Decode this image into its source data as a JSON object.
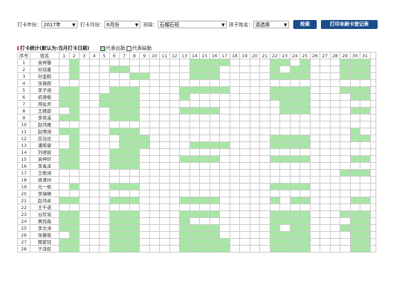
{
  "filters": {
    "year_label": "打卡年份：",
    "year_value": "2017年",
    "month_label": "打卡月份：",
    "month_value": "6月份",
    "class_label": "班级：",
    "class_value": "石榴石班",
    "child_label": "孩子姓名：",
    "child_value": "请选择",
    "search_button": "检索",
    "print_button": "打印未刷卡登记表"
  },
  "legend": {
    "title": "打卡统计(默认为:当月打卡日期)",
    "present_label": "代表出勤",
    "absent_label": "代表缺勤",
    "present_color": "#a8e6a6",
    "absent_color": "#ffffff"
  },
  "table": {
    "headers": [
      "序号",
      "姓名",
      "1",
      "2",
      "3",
      "4",
      "5",
      "6",
      "7",
      "8",
      "9",
      "10",
      "11",
      "12",
      "13",
      "14",
      "15",
      "16",
      "17",
      "18",
      "19",
      "20",
      "21",
      "22",
      "23",
      "24",
      "25",
      "26",
      "27",
      "28",
      "29",
      "30",
      "31"
    ],
    "rows": [
      {
        "no": "1",
        "name": "袁梓馨",
        "days": "0100000000000111100001101000111100"
      },
      {
        "no": "2",
        "name": "孙羽墨",
        "days": "0100011000000111000001011000111100"
      },
      {
        "no": "3",
        "name": "孙金鹤",
        "days": "0100000110000111000001111000111100"
      },
      {
        "no": "4",
        "name": "张瀚辰",
        "days": "0000000000000000000000000000000000"
      },
      {
        "no": "5",
        "name": "李子涵",
        "days": "1100011100001111100001111000111100"
      },
      {
        "no": "6",
        "name": "初语楷",
        "days": "1100111100001000000001111000011100"
      },
      {
        "no": "7",
        "name": "周祉灵",
        "days": "1100111100000000000000111000000000"
      },
      {
        "no": "8",
        "name": "王婧歆",
        "days": "0100011100001111000000111000011100"
      },
      {
        "no": "9",
        "name": "李将溪",
        "days": "1100011100000000000000000000000000"
      },
      {
        "no": "10",
        "name": "赵鸿雅",
        "days": "0000000000000000000000000000000000"
      },
      {
        "no": "11",
        "name": "赵晴涵",
        "days": "1100011100000000000000000000010000"
      },
      {
        "no": "12",
        "name": "房泊达",
        "days": "0100001110000000000001111000011100"
      },
      {
        "no": "13",
        "name": "潘皓睿",
        "days": "0100001110000111100001111000000000"
      },
      {
        "no": "14",
        "name": "刘语宸",
        "days": "1100011100000000000000000000000000"
      },
      {
        "no": "15",
        "name": "袁梓轩",
        "days": "1100011100001111000001111000011100"
      },
      {
        "no": "16",
        "name": "李禹泽",
        "days": "1100011100000000000000000000000000"
      },
      {
        "no": "17",
        "name": "王楔涵",
        "days": "0000000000000000000000000000111100"
      },
      {
        "no": "18",
        "name": "梁潇州",
        "days": "0000000000000000000000000000000000"
      },
      {
        "no": "19",
        "name": "元一帆",
        "days": "0100011100000000000001111000000000"
      },
      {
        "no": "20",
        "name": "李瑞琳",
        "days": "0000000000000000000000000000000100"
      },
      {
        "no": "21",
        "name": "赵鸿卓",
        "days": "1100011100001111000001011000011100"
      },
      {
        "no": "22",
        "name": "王千诺",
        "days": "0000000000000000000000000000000000"
      },
      {
        "no": "23",
        "name": "谷欣谣",
        "days": "1100011100001111000001111000111100"
      },
      {
        "no": "24",
        "name": "黄冠森",
        "days": "1100011100001000000001111000011100"
      },
      {
        "no": "25",
        "name": "李文涛",
        "days": "1100011100001111000001011000111100"
      },
      {
        "no": "26",
        "name": "张馨筱",
        "days": "0100011100001111000001111000011100"
      },
      {
        "no": "27",
        "name": "鲍紫钰",
        "days": "1100011100001111100001111000011100"
      },
      {
        "no": "28",
        "name": "于泽航",
        "days": "1100011100001111100001111000011100"
      }
    ]
  }
}
